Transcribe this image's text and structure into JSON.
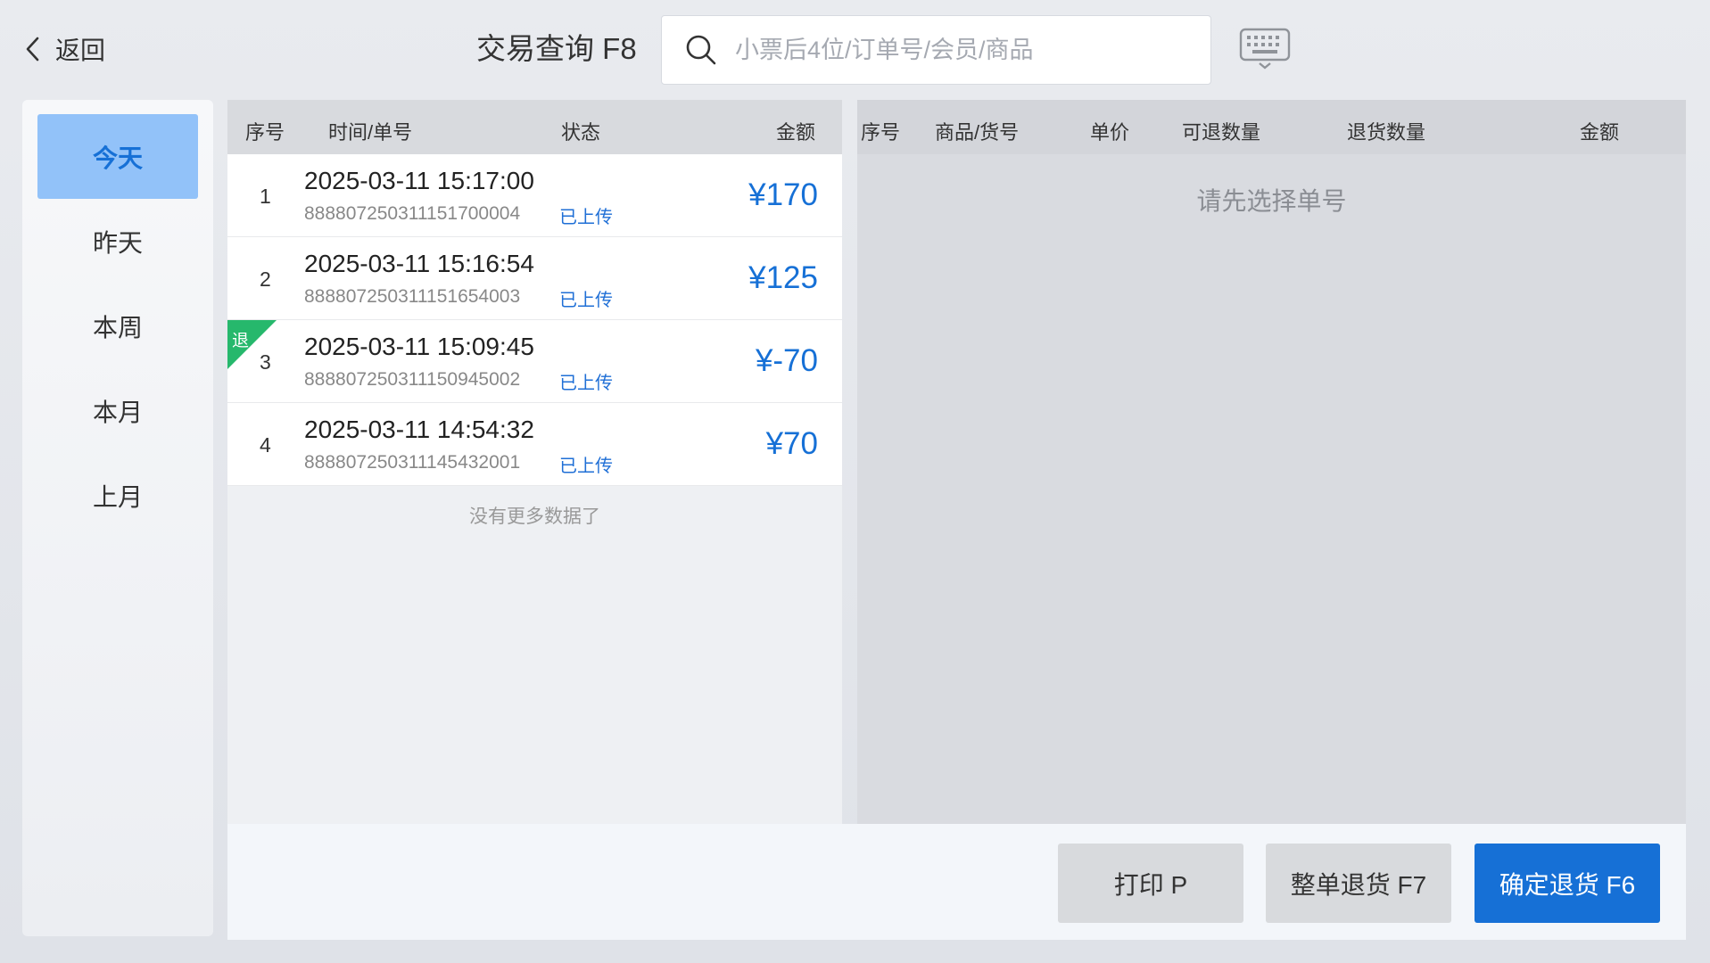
{
  "header": {
    "back_label": "返回",
    "title": "交易查询 F8",
    "search_placeholder": "小票后4位/订单号/会员/商品"
  },
  "sidebar": {
    "items": [
      {
        "label": "今天",
        "active": true
      },
      {
        "label": "昨天",
        "active": false
      },
      {
        "label": "本周",
        "active": false
      },
      {
        "label": "本月",
        "active": false
      },
      {
        "label": "上月",
        "active": false
      }
    ]
  },
  "order_list": {
    "columns": [
      "序号",
      "时间/单号",
      "状态",
      "金额"
    ],
    "rows": [
      {
        "seq": "1",
        "time": "2025-03-11 15:17:00",
        "order_no": "888807250311151700004",
        "status": "已上传",
        "amount": "¥170",
        "return_tag": ""
      },
      {
        "seq": "2",
        "time": "2025-03-11 15:16:54",
        "order_no": "888807250311151654003",
        "status": "已上传",
        "amount": "¥125",
        "return_tag": ""
      },
      {
        "seq": "3",
        "time": "2025-03-11 15:09:45",
        "order_no": "888807250311150945002",
        "status": "已上传",
        "amount": "¥-70",
        "return_tag": "退"
      },
      {
        "seq": "4",
        "time": "2025-03-11 14:54:32",
        "order_no": "888807250311145432001",
        "status": "已上传",
        "amount": "¥70",
        "return_tag": ""
      }
    ],
    "no_more": "没有更多数据了"
  },
  "detail": {
    "columns": [
      "序号",
      "商品/货号",
      "单价",
      "可退数量",
      "退货数量",
      "金额"
    ],
    "empty_tip": "请先选择单号"
  },
  "footer": {
    "print_label": "打印 P",
    "full_return_label": "整单退货 F7",
    "confirm_return_label": "确定退货 F6"
  },
  "colors": {
    "primary": "#1670d6",
    "active_tab_bg": "#92c2f9",
    "return_tag": "#26b86c",
    "status_text": "#1f6fd6"
  }
}
